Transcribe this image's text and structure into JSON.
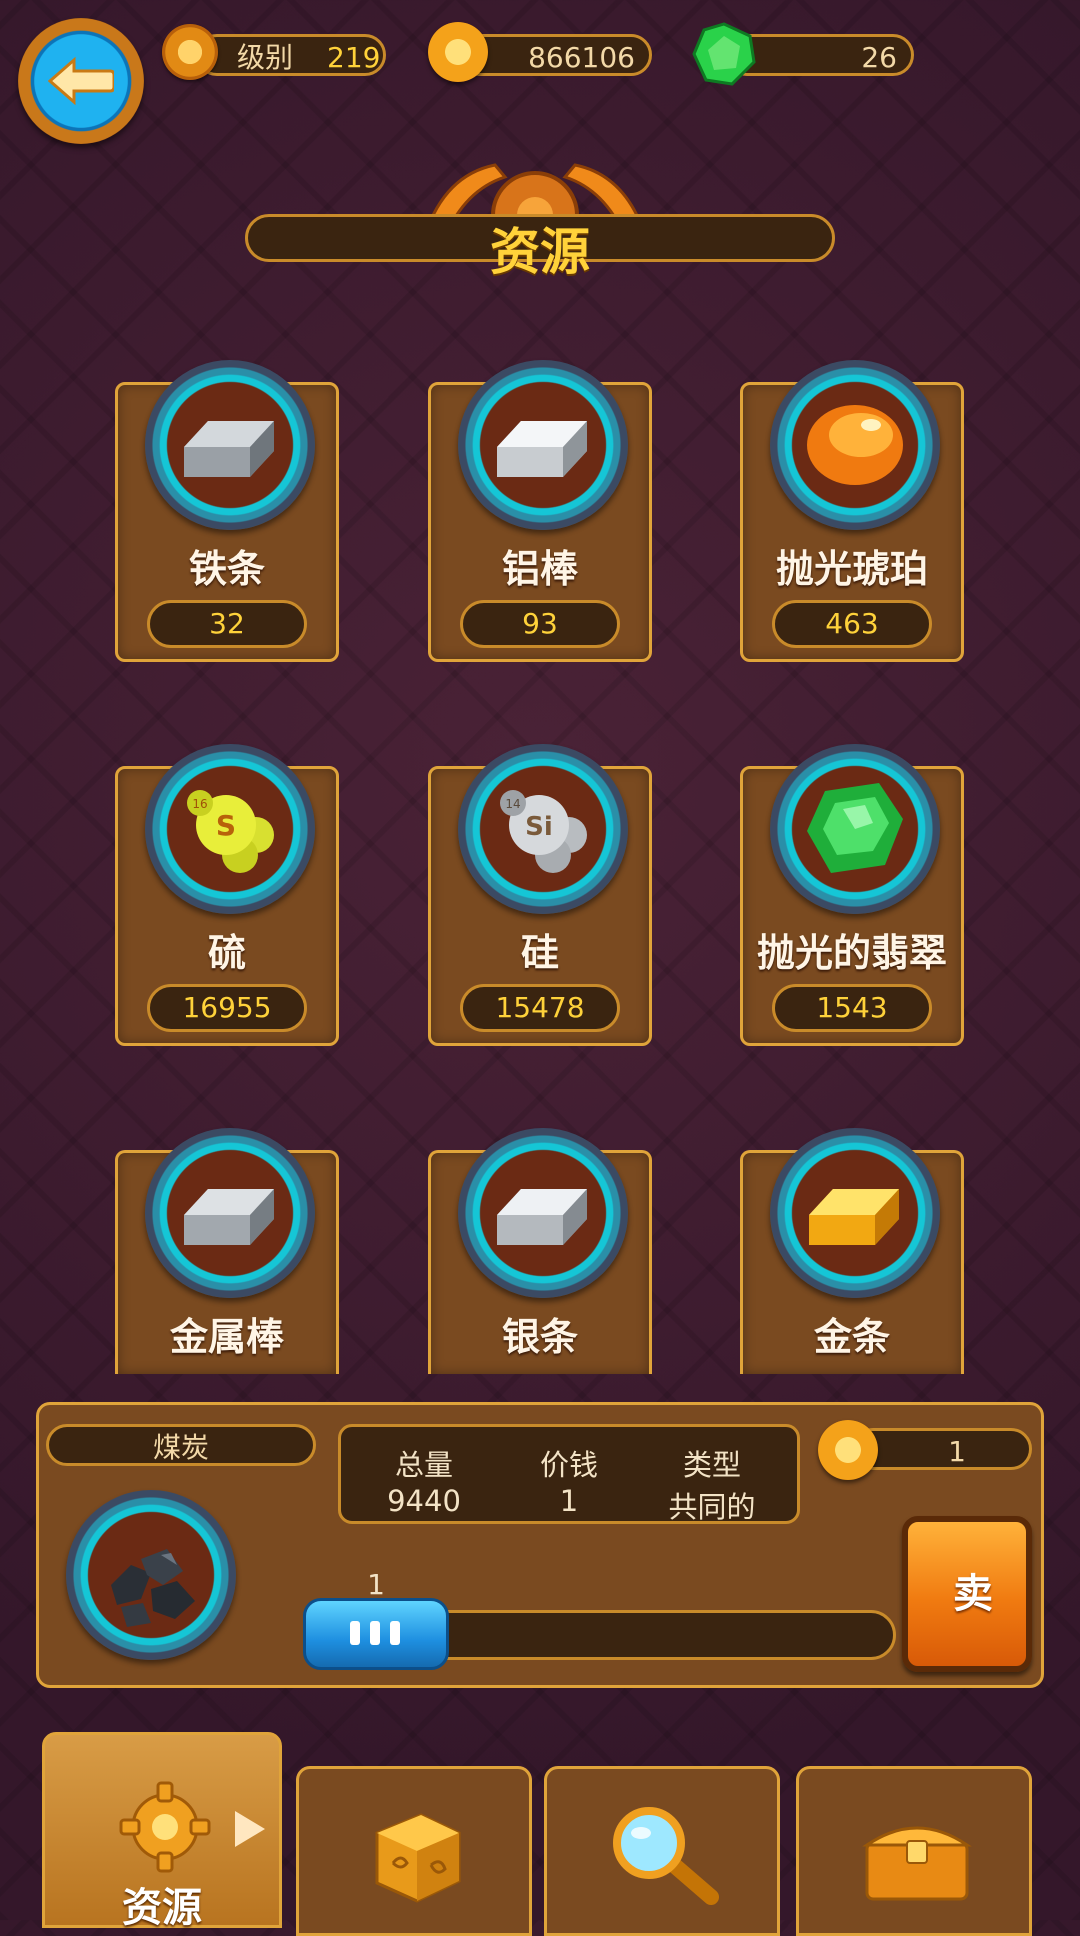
{
  "top_bar": {
    "level_label": "级别",
    "level_value": "219",
    "coins_value": "866106",
    "gems_value": "26"
  },
  "title": "资源",
  "resources": [
    {
      "name": "铁条",
      "count": "32",
      "icon": "iron-bar-icon"
    },
    {
      "name": "铝棒",
      "count": "93",
      "icon": "aluminum-bar-icon"
    },
    {
      "name": "抛光琥珀",
      "count": "463",
      "icon": "amber-icon"
    },
    {
      "name": "硫",
      "count": "16955",
      "icon": "sulfur-icon",
      "symbol": "S",
      "number": "16"
    },
    {
      "name": "硅",
      "count": "15478",
      "icon": "silicon-icon",
      "symbol": "Si",
      "number": "14"
    },
    {
      "name": "抛光的翡翠",
      "count": "1543",
      "icon": "emerald-icon"
    },
    {
      "name": "金属棒",
      "count": "",
      "icon": "metal-rod-icon"
    },
    {
      "name": "银条",
      "count": "",
      "icon": "silver-bar-icon"
    },
    {
      "name": "金条",
      "count": "",
      "icon": "gold-bar-icon"
    }
  ],
  "selected": {
    "name": "煤炭",
    "total_label": "总量",
    "total_value": "9440",
    "price_label": "价钱",
    "price_value": "1",
    "type_label": "类型",
    "type_value": "共同的",
    "sell_price": "1",
    "quantity": "1",
    "sell_label": "卖"
  },
  "tabs": [
    {
      "label": "资源",
      "icon": "gear-icon",
      "active": true
    },
    {
      "label": "",
      "icon": "dice-icon"
    },
    {
      "label": "",
      "icon": "magnifier-icon"
    },
    {
      "label": "",
      "icon": "chest-icon"
    }
  ],
  "colors": {
    "background": "#3b1a2c",
    "card": "#7a4a20",
    "gold_text": "#ffd23a",
    "accent_blue": "#1fb2f0",
    "sell_orange": "#f07a10"
  }
}
